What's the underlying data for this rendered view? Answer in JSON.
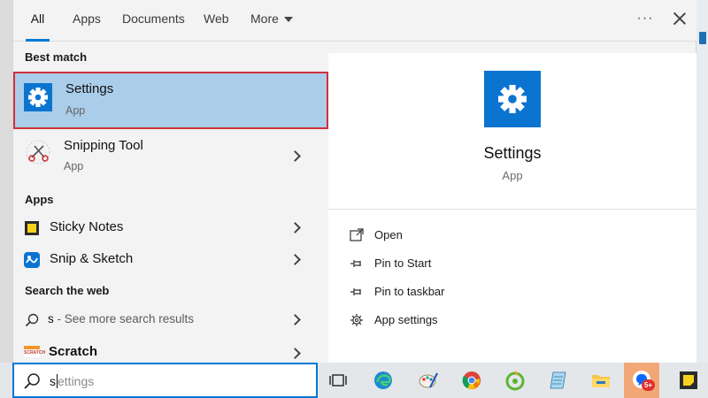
{
  "tabs": [
    {
      "label": "All"
    },
    {
      "label": "Apps"
    },
    {
      "label": "Documents"
    },
    {
      "label": "Web"
    },
    {
      "label": "More"
    }
  ],
  "header": {
    "more_options_glyph": "···"
  },
  "sections": {
    "best_match": "Best match",
    "apps": "Apps",
    "search_web": "Search the web"
  },
  "best_match": {
    "name": "Settings",
    "type": "App",
    "icon": "gear-icon"
  },
  "snipping_tool": {
    "name": "Snipping Tool",
    "type": "App",
    "icon": "snipping-tool-icon"
  },
  "apps": [
    {
      "name": "Sticky Notes",
      "icon": "sticky-notes-icon"
    },
    {
      "name": "Snip & Sketch",
      "icon": "snip-sketch-icon"
    }
  ],
  "web_result": {
    "query": "s",
    "suffix": " - See more search results"
  },
  "scratch": {
    "name": "Scratch",
    "icon_text": "SCRATCH"
  },
  "detail": {
    "title": "Settings",
    "subtitle": "App",
    "actions": [
      {
        "label": "Open",
        "icon": "open-icon"
      },
      {
        "label": "Pin to Start",
        "icon": "pin-icon"
      },
      {
        "label": "Pin to taskbar",
        "icon": "pin-icon"
      },
      {
        "label": "App settings",
        "icon": "gear-icon"
      }
    ]
  },
  "search": {
    "typed": "s",
    "suggestion_rest": "ettings"
  },
  "taskbar": {
    "items": [
      {
        "icon": "task-view-icon"
      },
      {
        "icon": "edge-icon"
      },
      {
        "icon": "paint-icon"
      },
      {
        "icon": "chrome-icon"
      },
      {
        "icon": "coccoc-icon"
      },
      {
        "icon": "notepad-icon"
      },
      {
        "icon": "file-explorer-icon"
      },
      {
        "icon": "zalo-icon",
        "badge": "5+"
      },
      {
        "icon": "sticky-notes-icon"
      }
    ]
  },
  "colors": {
    "accent": "#0078d4",
    "selection": "#aacde9",
    "highlight_border": "#d32f3a",
    "settings_tile": "#0b74d1"
  }
}
